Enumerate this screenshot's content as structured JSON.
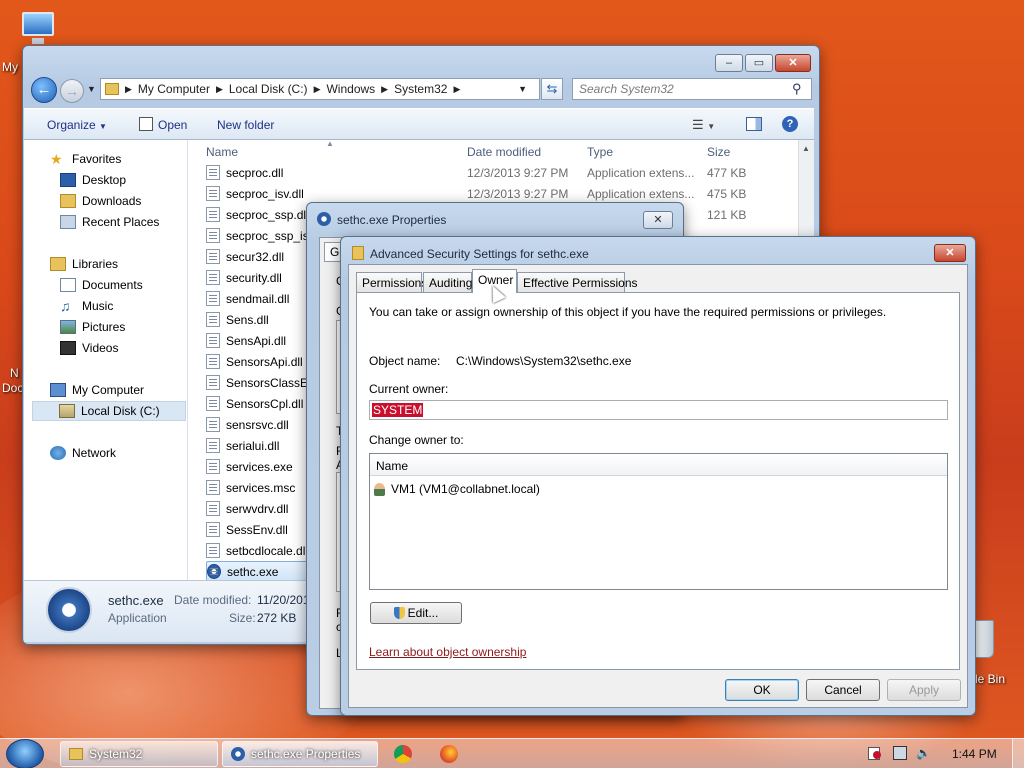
{
  "desktop": {
    "icons": [
      "My",
      "N",
      "Doc",
      "le Bin"
    ]
  },
  "explorer": {
    "breadcrumb": [
      "My Computer",
      "Local Disk (C:)",
      "Windows",
      "System32"
    ],
    "search_placeholder": "Search System32",
    "toolbar": {
      "organize": "Organize",
      "open": "Open",
      "new_folder": "New folder"
    },
    "nav": {
      "favorites": "Favorites",
      "desktop": "Desktop",
      "downloads": "Downloads",
      "recent": "Recent Places",
      "libraries": "Libraries",
      "documents": "Documents",
      "music": "Music",
      "pictures": "Pictures",
      "videos": "Videos",
      "computer": "My Computer",
      "localdisk": "Local Disk (C:)",
      "network": "Network"
    },
    "columns": {
      "name": "Name",
      "date": "Date modified",
      "type": "Type",
      "size": "Size"
    },
    "files": [
      {
        "name": "secproc.dll",
        "date": "12/3/2013 9:27 PM",
        "type": "Application extens...",
        "size": "477 KB"
      },
      {
        "name": "secproc_isv.dll",
        "date": "12/3/2013 9:27 PM",
        "type": "Application extens...",
        "size": "475 KB"
      },
      {
        "name": "secproc_ssp.dll",
        "date": "",
        "type": "",
        "size": "121 KB"
      },
      {
        "name": "secproc_ssp_isv",
        "date": "",
        "type": "",
        "size": ""
      },
      {
        "name": "secur32.dll",
        "date": "",
        "type": "",
        "size": ""
      },
      {
        "name": "security.dll",
        "date": "",
        "type": "",
        "size": ""
      },
      {
        "name": "sendmail.dll",
        "date": "",
        "type": "",
        "size": ""
      },
      {
        "name": "Sens.dll",
        "date": "",
        "type": "",
        "size": ""
      },
      {
        "name": "SensApi.dll",
        "date": "",
        "type": "",
        "size": ""
      },
      {
        "name": "SensorsApi.dll",
        "date": "",
        "type": "",
        "size": ""
      },
      {
        "name": "SensorsClassEx",
        "date": "",
        "type": "",
        "size": ""
      },
      {
        "name": "SensorsCpl.dll",
        "date": "",
        "type": "",
        "size": ""
      },
      {
        "name": "sensrsvc.dll",
        "date": "",
        "type": "",
        "size": ""
      },
      {
        "name": "serialui.dll",
        "date": "",
        "type": "",
        "size": ""
      },
      {
        "name": "services.exe",
        "date": "",
        "type": "",
        "size": ""
      },
      {
        "name": "services.msc",
        "date": "",
        "type": "",
        "size": ""
      },
      {
        "name": "serwvdrv.dll",
        "date": "",
        "type": "",
        "size": ""
      },
      {
        "name": "SessEnv.dll",
        "date": "",
        "type": "",
        "size": ""
      },
      {
        "name": "setbcdlocale.dl",
        "date": "",
        "type": "",
        "size": ""
      },
      {
        "name": "sethc.exe",
        "date": "",
        "type": "",
        "size": ""
      }
    ],
    "details": {
      "name": "sethc.exe",
      "kind": "Application",
      "date_label": "Date modified:",
      "date_value": "11/20/201",
      "size_label": "Size:",
      "size_value": "272 KB"
    }
  },
  "properties": {
    "title": "sethc.exe Properties",
    "fragments": {
      "tab": "Ge",
      "a": "C",
      "b": "G",
      "c": "T",
      "d": "F",
      "e": "A",
      "f": "F",
      "g": "c",
      "h": "L"
    }
  },
  "advanced": {
    "title": "Advanced Security Settings for sethc.exe",
    "tabs": [
      "Permissions",
      "Auditing",
      "Owner",
      "Effective Permissions"
    ],
    "intro": "You can take or assign ownership of this object if you have the required permissions or privileges.",
    "object_name_label": "Object name:",
    "object_name_value": "C:\\Windows\\System32\\sethc.exe",
    "current_owner_label": "Current owner:",
    "current_owner_value": "SYSTEM",
    "change_owner_label": "Change owner to:",
    "list_header": "Name",
    "owner_candidate": "VM1 (VM1@collabnet.local)",
    "edit_button": "Edit...",
    "learn_link": "Learn about object ownership",
    "ok": "OK",
    "cancel": "Cancel",
    "apply": "Apply"
  },
  "taskbar": {
    "items": [
      "System32",
      "sethc.exe Properties"
    ],
    "time": "1:44 PM"
  }
}
